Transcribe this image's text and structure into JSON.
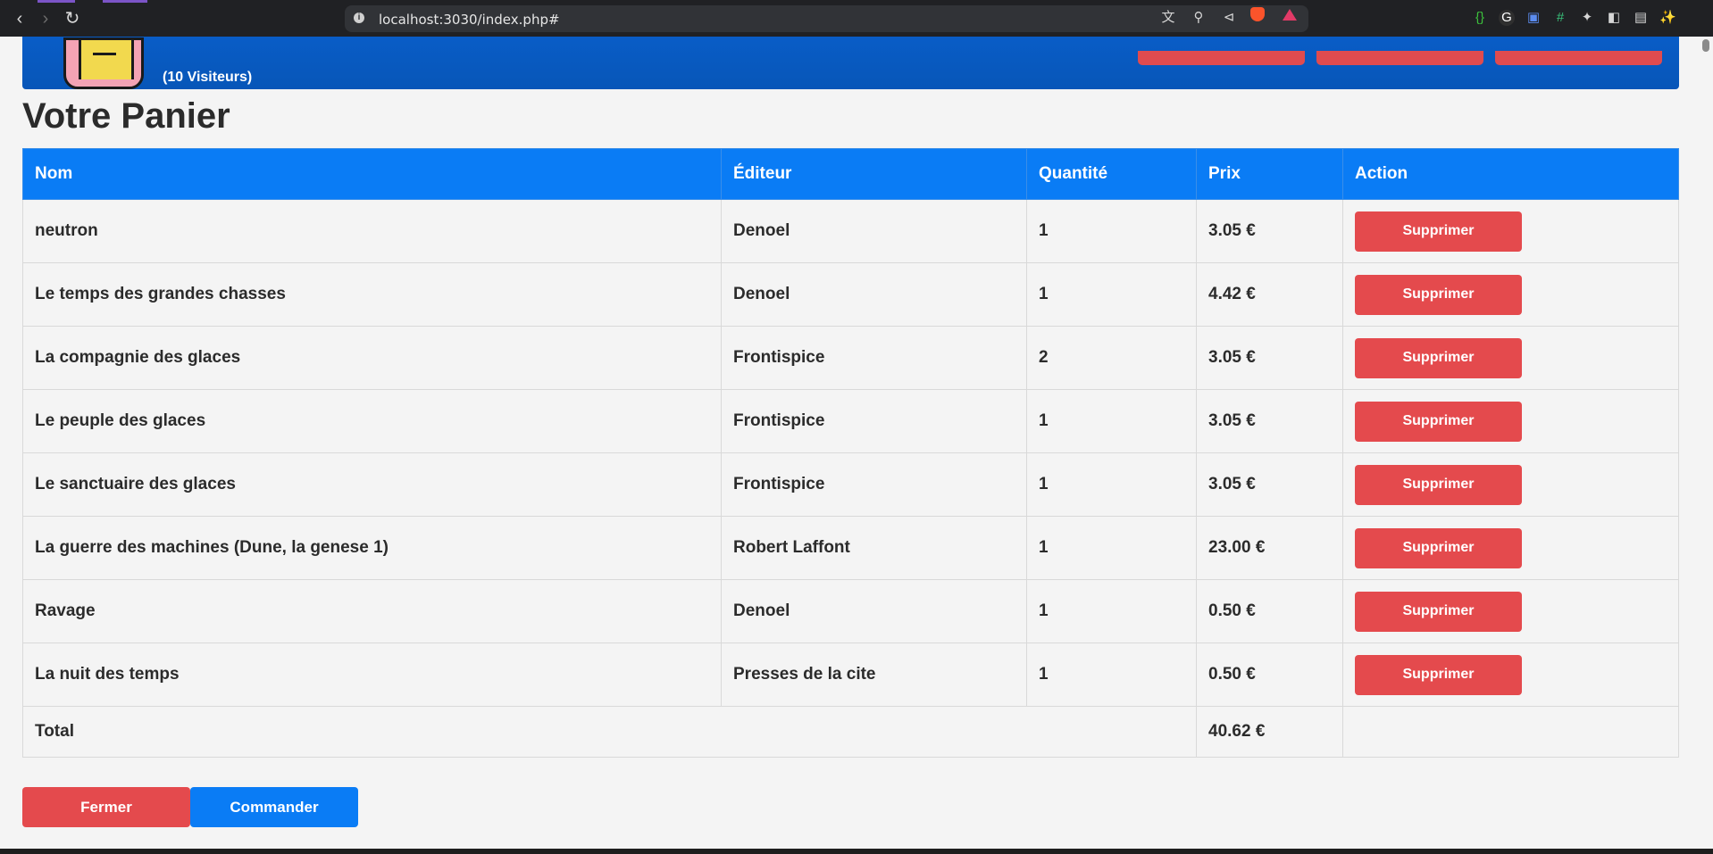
{
  "browser": {
    "url": "localhost:3030/index.php#",
    "icons": [
      "back-icon",
      "forward-icon",
      "reload-icon",
      "info-icon",
      "translate-icon",
      "zoom-icon",
      "share-icon",
      "brave-shield-icon",
      "brave-rewards-icon",
      "extension-icon",
      "sidebar-icon",
      "wallet-icon",
      "leo-icon"
    ]
  },
  "header": {
    "visitors": "(10 Visiteurs)"
  },
  "cart": {
    "title": "Votre Panier",
    "columns": {
      "nom": "Nom",
      "editeur": "Éditeur",
      "quantite": "Quantité",
      "prix": "Prix",
      "action": "Action"
    },
    "rows": [
      {
        "nom": "neutron",
        "editeur": "Denoel",
        "quantite": "1",
        "prix": "3.05 €",
        "action": "Supprimer"
      },
      {
        "nom": "Le temps des grandes chasses",
        "editeur": "Denoel",
        "quantite": "1",
        "prix": "4.42 €",
        "action": "Supprimer"
      },
      {
        "nom": "La compagnie des glaces",
        "editeur": "Frontispice",
        "quantite": "2",
        "prix": "3.05 €",
        "action": "Supprimer"
      },
      {
        "nom": "Le peuple des glaces",
        "editeur": "Frontispice",
        "quantite": "1",
        "prix": "3.05 €",
        "action": "Supprimer"
      },
      {
        "nom": "Le sanctuaire des glaces",
        "editeur": "Frontispice",
        "quantite": "1",
        "prix": "3.05 €",
        "action": "Supprimer"
      },
      {
        "nom": "La guerre des machines (Dune, la genese 1)",
        "editeur": "Robert Laffont",
        "quantite": "1",
        "prix": "23.00 €",
        "action": "Supprimer"
      },
      {
        "nom": "Ravage",
        "editeur": "Denoel",
        "quantite": "1",
        "prix": "0.50 €",
        "action": "Supprimer"
      },
      {
        "nom": "La nuit des temps",
        "editeur": "Presses de la cite",
        "quantite": "1",
        "prix": "0.50 €",
        "action": "Supprimer"
      }
    ],
    "total_label": "Total",
    "total_value": "40.62 €"
  },
  "buttons": {
    "close": "Fermer",
    "order": "Commander"
  },
  "colors": {
    "header_blue": "#0756b8",
    "table_header": "#0a7cf5",
    "danger": "#e44a4d",
    "primary": "#0a7cf5"
  }
}
